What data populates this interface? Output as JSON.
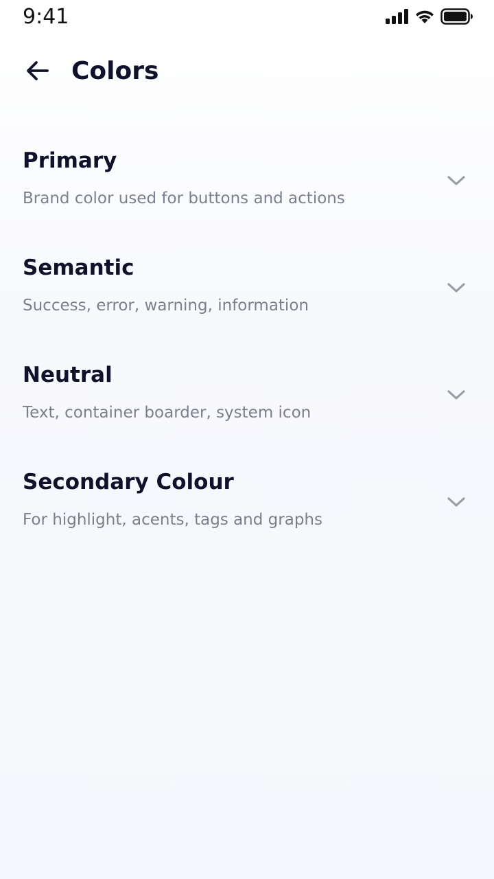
{
  "status_bar": {
    "time": "9:41",
    "icons": [
      "cellular-signal-icon",
      "wifi-icon",
      "battery-icon"
    ]
  },
  "header": {
    "back_icon": "arrow-left-icon",
    "title": "Colors"
  },
  "color_groups": [
    {
      "title": "Primary",
      "description": "Brand color used for buttons and actions",
      "icon": "chevron-down-icon"
    },
    {
      "title": "Semantic",
      "description": "Success, error, warning, information",
      "icon": "chevron-down-icon"
    },
    {
      "title": "Neutral",
      "description": "Text, container boarder, system icon",
      "icon": "chevron-down-icon"
    },
    {
      "title": "Secondary Colour",
      "description": "For highlight, acents, tags and graphs",
      "icon": "chevron-down-icon"
    }
  ],
  "colors": {
    "title_text": "#11112b",
    "description_text": "#7d7f8c",
    "chevron": "#9a9ca6",
    "background": "#f5f7fc"
  }
}
